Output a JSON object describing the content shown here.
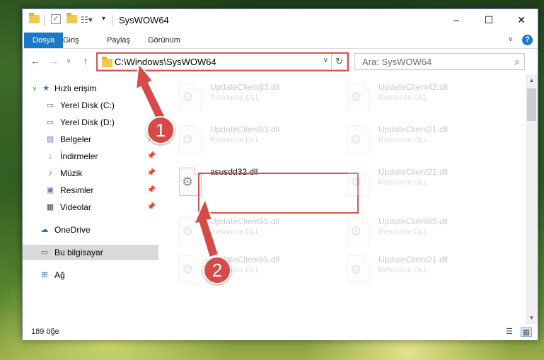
{
  "window": {
    "title": "SysWOW64",
    "controls": {
      "minimize": "–",
      "maximize": "☐",
      "close": "✕"
    }
  },
  "ribbon": {
    "tabs": [
      "Dosya",
      "Giriş",
      "Paylaş",
      "Görünüm"
    ],
    "help": "?"
  },
  "address": {
    "path": "C:\\Windows\\SysWOW64",
    "search_placeholder": "Ara: SysWOW64"
  },
  "sidebar": {
    "quick_access": "Hızlı erişim",
    "items": [
      {
        "label": "Yerel Disk (C:)",
        "icon": "drive-icon",
        "pinned": false
      },
      {
        "label": "Yerel Disk (D:)",
        "icon": "drive-icon",
        "pinned": false
      },
      {
        "label": "Belgeler",
        "icon": "documents-icon",
        "pinned": true
      },
      {
        "label": "İndirmeler",
        "icon": "downloads-icon",
        "pinned": true
      },
      {
        "label": "Müzik",
        "icon": "music-icon",
        "pinned": true
      },
      {
        "label": "Resimler",
        "icon": "pictures-icon",
        "pinned": true
      },
      {
        "label": "Videolar",
        "icon": "videos-icon",
        "pinned": true
      }
    ],
    "onedrive": "OneDrive",
    "this_pc": "Bu bilgisayar",
    "network": "Ağ"
  },
  "files": {
    "left_column": [
      {
        "name": "UpdateClient63.dll",
        "type": "Resource DLL",
        "faded": true
      },
      {
        "name": "UpdateClient63.dll",
        "type": "Resource DLL",
        "faded": true
      },
      {
        "name": "asusdd32.dll",
        "type": "",
        "faded": false
      },
      {
        "name": "UpdateClient65.dll",
        "type": "Resource DLL",
        "faded": true
      },
      {
        "name": "UpdateClient65.dll",
        "type": "Resource DLL",
        "faded": true
      }
    ],
    "right_column": [
      {
        "name": "UpdateClient42.dll",
        "type": "Resource DLL",
        "faded": true
      },
      {
        "name": "UpdateClient21.dll",
        "type": "Resource DLL",
        "faded": true
      },
      {
        "name": "UpdateClient21.dll",
        "type": "Resource DLL",
        "faded": true
      },
      {
        "name": "UpdateClient65.dll",
        "type": "Resource DLL",
        "faded": true
      },
      {
        "name": "UpdateClient21.dll",
        "type": "Resource DLL",
        "faded": true
      }
    ]
  },
  "status": {
    "item_count": "189 öğe"
  },
  "annotations": {
    "step1": "1",
    "step2": "2"
  },
  "colors": {
    "accent": "#1979ca",
    "highlight": "#d9534f",
    "callout": "#d64a47"
  }
}
